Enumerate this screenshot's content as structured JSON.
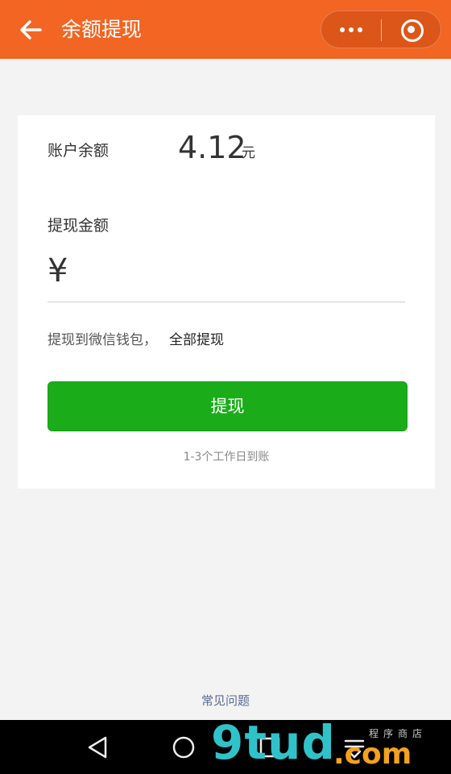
{
  "header": {
    "title": "余额提现",
    "back_icon": "arrow-left-icon",
    "more_icon": "more-dots-icon",
    "close_icon": "target-close-icon",
    "background_color": "#f26522"
  },
  "balance": {
    "label": "账户余额",
    "value": "4.12",
    "unit": "元"
  },
  "withdraw": {
    "amount_label": "提现金额",
    "currency_symbol": "¥",
    "amount_value": "",
    "hint_prefix": "提现到微信钱包，",
    "withdraw_all_label": "全部提现",
    "submit_label": "提现",
    "submit_color": "#1aad19",
    "arrival_note": "1-3个工作日到账"
  },
  "footer": {
    "faq_label": "常见问题"
  },
  "system_nav": {
    "back_icon": "triangle-back-icon",
    "home_icon": "circle-home-icon",
    "recents_icon": "square-recents-icon",
    "menu_icon": "menu-down-icon"
  },
  "watermark": {
    "logo_text": "9tud",
    "domain": ".com",
    "tagline": "程序商店"
  }
}
